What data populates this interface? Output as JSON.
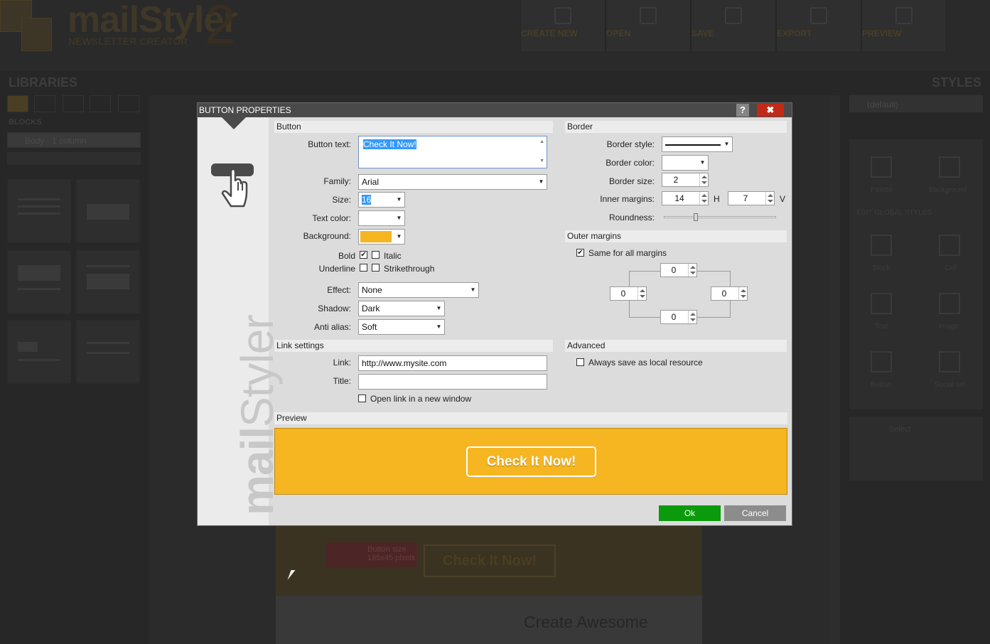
{
  "app": {
    "logo_main": "mailStyler",
    "logo_num": "2",
    "logo_sub": "NEWSLETTER CREATOR",
    "toolbar": [
      "CREATE NEW",
      "OPEN",
      "SAVE",
      "EXPORT",
      "PREVIEW"
    ],
    "libraries_title": "LIBRARIES",
    "styles_title": "STYLES",
    "blocks_label": "BLOCKS",
    "blocks_select": "Body - 1 column",
    "styles_select": "(default)",
    "edit_global_styles": "EDIT GLOBAL STYLES",
    "style_items": [
      "Palette",
      "Background",
      "Block",
      "Cell",
      "Text",
      "Image",
      "Button",
      "Social set"
    ],
    "select_label": "Select",
    "canvas_button_text": "Check It Now!",
    "button_size_tip": [
      "Button size",
      "185x45 pixels"
    ],
    "canvas_heading": "Create Awesome"
  },
  "dialog": {
    "title": "BUTTON PROPERTIES",
    "help": "?",
    "close": "✖",
    "brand": "mailStyler",
    "colors": {
      "accent": "#f5b622",
      "ok": "#0b9a0b",
      "cancel": "#8c8c8c",
      "close": "#c22a17"
    },
    "button_section": {
      "title": "Button",
      "text_label": "Button text:",
      "text_value": "Check It Now!",
      "family_label": "Family:",
      "family_value": "Arial",
      "size_label": "Size:",
      "size_value": "16",
      "text_color_label": "Text color:",
      "text_color_value": "#ffffff",
      "background_label": "Background:",
      "background_value": "#f5b622",
      "bold_label": "Bold",
      "bold_checked": true,
      "italic_label": "Italic",
      "italic_checked": false,
      "underline_label": "Underline",
      "underline_checked": false,
      "strike_label": "Strikethrough",
      "strike_checked": false,
      "effect_label": "Effect:",
      "effect_value": "None",
      "shadow_label": "Shadow:",
      "shadow_value": "Dark",
      "antialias_label": "Anti alias:",
      "antialias_value": "Soft"
    },
    "border_section": {
      "title": "Border",
      "style_label": "Border style:",
      "color_label": "Border color:",
      "color_value": "#ffffff",
      "size_label": "Border size:",
      "size_value": "2",
      "inner_label": "Inner margins:",
      "inner_h": "14",
      "h_label": "H",
      "inner_v": "7",
      "v_label": "V",
      "roundness_label": "Roundness:",
      "roundness_level": 0.27
    },
    "outer_section": {
      "title": "Outer margins",
      "same_label": "Same for all margins",
      "same_checked": true,
      "top": "0",
      "left": "0",
      "right": "0",
      "bottom": "0"
    },
    "link_section": {
      "title": "Link settings",
      "link_label": "Link:",
      "link_value": "http://www.mysite.com",
      "title_label": "Title:",
      "title_value": "",
      "new_window_label": "Open link in a new window",
      "new_window_checked": false
    },
    "advanced_section": {
      "title": "Advanced",
      "local_label": "Always save as local resource",
      "local_checked": false
    },
    "preview_section": {
      "title": "Preview",
      "button_text": "Check It Now!"
    },
    "ok_label": "Ok",
    "cancel_label": "Cancel"
  }
}
